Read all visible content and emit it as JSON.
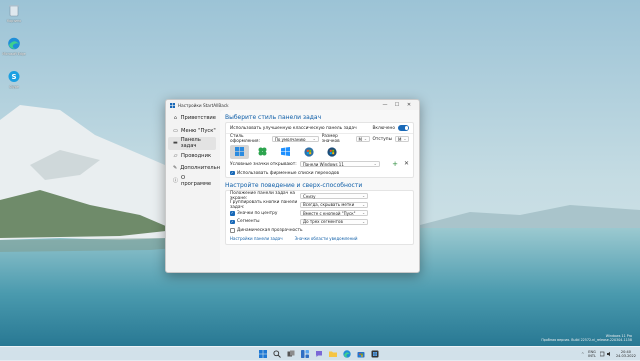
{
  "desktop": {
    "icons": [
      {
        "label": "Корзина",
        "icon": "recycle-bin-icon"
      },
      {
        "label": "Microsoft Edge",
        "icon": "edge-icon"
      },
      {
        "label": "Skype",
        "icon": "skype-icon"
      }
    ]
  },
  "window": {
    "title": "Настройки StartAllBack",
    "controls": {
      "minimize": "—",
      "maximize": "☐",
      "close": "✕"
    }
  },
  "sidebar": {
    "items": [
      {
        "label": "Приветствие",
        "icon": "home-icon",
        "active": false
      },
      {
        "label": "Меню \"Пуск\"",
        "icon": "start-menu-icon",
        "active": false
      },
      {
        "label": "Панель задач",
        "icon": "taskbar-icon",
        "active": true
      },
      {
        "label": "Проводник",
        "icon": "folder-icon",
        "active": false
      },
      {
        "label": "Дополнительно",
        "icon": "wrench-icon",
        "active": false
      },
      {
        "label": "О программе",
        "icon": "info-icon",
        "active": false
      }
    ]
  },
  "main": {
    "section1_title": "Выберите стиль панели задач",
    "classic_label": "Использовать улучшенную классическую панель задач",
    "classic_state": "Включено",
    "style_label": "Стиль оформления:",
    "style_value": "По умолчанию",
    "size_label": "Размер значков",
    "size_value": "M",
    "margins_label": "Отступы",
    "margins_value": "M",
    "styles": [
      {
        "name": "windows-11-style",
        "selected": true
      },
      {
        "name": "clover-style",
        "selected": false
      },
      {
        "name": "windows-10-style",
        "selected": false
      },
      {
        "name": "windows-7-style",
        "selected": false
      },
      {
        "name": "windows-vista-style",
        "selected": false
      }
    ],
    "open_with_label": "Условные значки открывают:",
    "open_with_value": "Панели Windows 11",
    "jump_lists_label": "Использовать фирменные списки переходов",
    "section2_title": "Настройте поведение и сверх-способности",
    "behavior": [
      {
        "label": "Положение панели задач на экране:",
        "value": "Снизу",
        "checkbox": false
      },
      {
        "label": "Группировать кнопки панели задач:",
        "value": "Всегда, скрывать метки",
        "checkbox": false
      },
      {
        "label": "Значки по центру",
        "value": "Вместе с кнопкой \"Пуск\"",
        "checkbox": true
      },
      {
        "label": "Сегменты",
        "value": "До трех сегментов",
        "checkbox": true
      },
      {
        "label": "Динамическая прозрачность",
        "value": "",
        "checkbox": false
      }
    ],
    "links": [
      "Настройки панели задач",
      "Значки области уведомлений"
    ]
  },
  "watermark": {
    "line1": "Windows 11 Pro",
    "line2": "Пробная версия. Build 22572.ni_release.220304-1158"
  },
  "tray": {
    "lang": "ENG",
    "lang2": "INTL",
    "time": "20:40",
    "date": "24.03.2022",
    "chevron": "^"
  },
  "colors": {
    "accent": "#1868b7",
    "title_blue": "#0e5ea8"
  }
}
